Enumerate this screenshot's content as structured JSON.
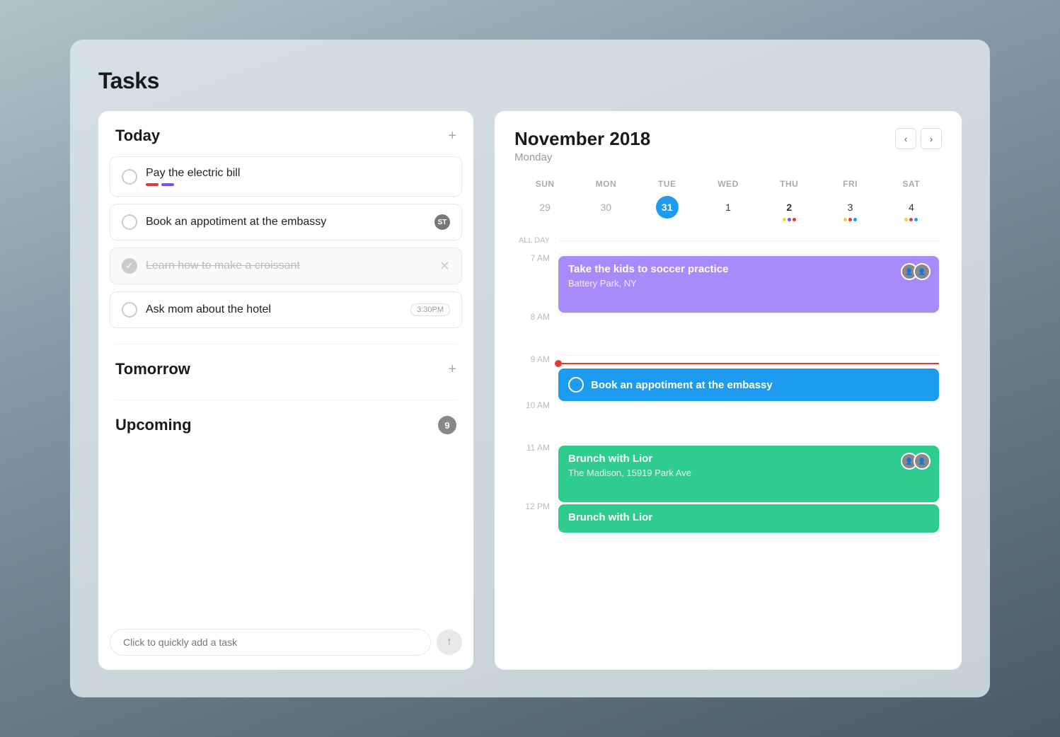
{
  "app": {
    "title": "Tasks"
  },
  "left": {
    "today_label": "Today",
    "tomorrow_label": "Tomorrow",
    "upcoming_label": "Upcoming",
    "upcoming_count": "9",
    "quick_add_placeholder": "Click to quickly add a task",
    "tasks": [
      {
        "id": "task-1",
        "label": "Pay the electric bill",
        "completed": false,
        "priority_colors": [
          "#e53935",
          "#7c4dff"
        ],
        "badge": null,
        "time": null
      },
      {
        "id": "task-2",
        "label": "Book an appotiment at the embassy",
        "completed": false,
        "priority_colors": [],
        "badge": "ST",
        "time": null
      },
      {
        "id": "task-3",
        "label": "Learn how to make a croissant",
        "completed": true,
        "priority_colors": [],
        "badge": null,
        "time": null
      },
      {
        "id": "task-4",
        "label": "Ask mom about the hotel",
        "completed": false,
        "priority_colors": [],
        "badge": null,
        "time": "3:30PM"
      }
    ]
  },
  "calendar": {
    "month_year": "November 2018",
    "day_name": "Monday",
    "nav_prev": "‹",
    "nav_next": "›",
    "day_headers": [
      "SUN",
      "MON",
      "TUE",
      "WED",
      "THU",
      "FRI",
      "SAT"
    ],
    "dates": [
      {
        "num": "29",
        "type": "prev"
      },
      {
        "num": "30",
        "type": "prev"
      },
      {
        "num": "31",
        "type": "today"
      },
      {
        "num": "1",
        "type": "current"
      },
      {
        "num": "2",
        "type": "current",
        "bold": true,
        "dots": [
          "#f9c846",
          "#7c4dff",
          "#e53935"
        ]
      },
      {
        "num": "3",
        "type": "current",
        "dots": [
          "#f9c846",
          "#e53935",
          "#1d9bf0"
        ]
      },
      {
        "num": "4",
        "type": "current",
        "dots": [
          "#f9c846",
          "#e53935",
          "#1d9bf0"
        ]
      }
    ],
    "time_slots": [
      "7 AM",
      "8 AM",
      "",
      "9 AM",
      "10 AM",
      "11 AM",
      "12 PM"
    ],
    "events": [
      {
        "time": "7 AM",
        "type": "block",
        "color": "#a78bfa",
        "title": "Take the kids to soccer practice",
        "location": "Battery Park, NY",
        "avatars": true
      },
      {
        "time": "9 AM",
        "type": "task",
        "color": "#1d9bf0",
        "title": "Book an appotiment at the embassy",
        "is_now": true
      },
      {
        "time": "11 AM",
        "type": "block",
        "color": "#2ecc8e",
        "title": "Brunch with Lior",
        "location": "The Madison, 15919 Park Ave",
        "avatars": true
      },
      {
        "time": "12 PM",
        "type": "block",
        "color": "#2ecc8e",
        "title": "Brunch with Lior",
        "location": null,
        "avatars": false
      }
    ]
  }
}
